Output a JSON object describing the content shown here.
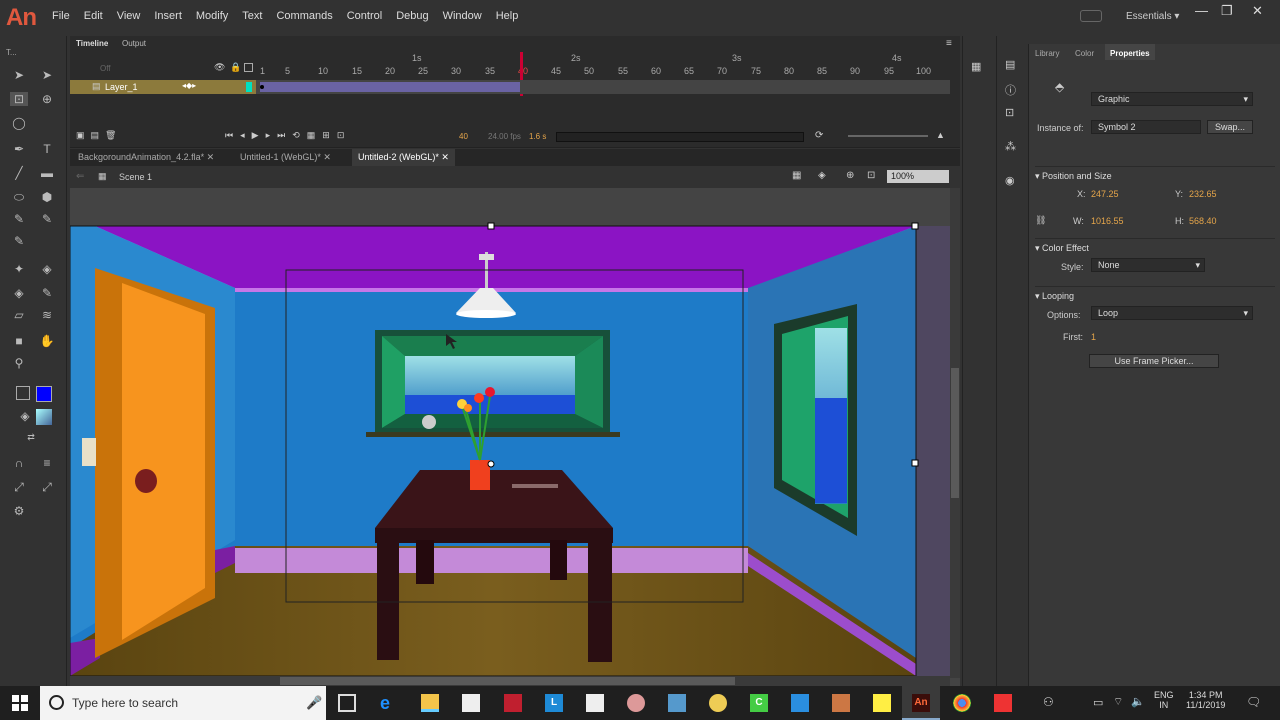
{
  "app": {
    "logo": "An",
    "menu": [
      "File",
      "Edit",
      "View",
      "Insert",
      "Modify",
      "Text",
      "Commands",
      "Control",
      "Debug",
      "Window",
      "Help"
    ],
    "workspace": "Essentials",
    "workspace_caret": "▾",
    "window_controls": [
      "—",
      "❐",
      "✕"
    ]
  },
  "toolbar": {
    "title": "T..."
  },
  "timeline": {
    "tabs": [
      "Timeline",
      "Output"
    ],
    "layer": "Layer_1",
    "seconds": [
      "1s",
      "2s",
      "3s",
      "4s"
    ],
    "frames": [
      "1",
      "5",
      "10",
      "15",
      "20",
      "25",
      "30",
      "35",
      "40",
      "45",
      "50",
      "55",
      "60",
      "65",
      "70",
      "75",
      "80",
      "85",
      "90",
      "95",
      "100"
    ],
    "current_frame": "40",
    "fps": "24.00 fps",
    "time": "1.6 s",
    "off_label": "Off"
  },
  "documents": {
    "tabs": [
      "BackgoroundAnimation_4.2.fla*",
      "Untitled-1 (WebGL)*",
      "Untitled-2 (WebGL)*"
    ],
    "close": "✕"
  },
  "scene": {
    "name": "Scene 1",
    "zoom": "100%"
  },
  "properties": {
    "tabs": [
      "Library",
      "Color",
      "Properties"
    ],
    "type": "Graphic",
    "instance_label": "Instance of:",
    "instance": "Symbol 2",
    "swap": "Swap...",
    "position_section": "Position and Size",
    "x_label": "X:",
    "x": "247.25",
    "y_label": "Y:",
    "y": "232.65",
    "w_label": "W:",
    "w": "1016.55",
    "h_label": "H:",
    "h": "568.40",
    "color_section": "Color Effect",
    "style_label": "Style:",
    "style": "None",
    "looping_section": "Looping",
    "options_label": "Options:",
    "options": "Loop",
    "first_label": "First:",
    "first": "1",
    "frame_picker": "Use Frame Picker..."
  },
  "taskbar": {
    "search_placeholder": "Type here to search",
    "lang1": "ENG",
    "lang2": "IN",
    "time": "1:34 PM",
    "date": "11/1/2019"
  },
  "colors": {
    "accent": "#f7941e",
    "ceiling": "#8b14c4",
    "wall": "#1e7bc8",
    "floor": "#6b5212",
    "door": "#f7941e",
    "table": "#3a1418"
  }
}
